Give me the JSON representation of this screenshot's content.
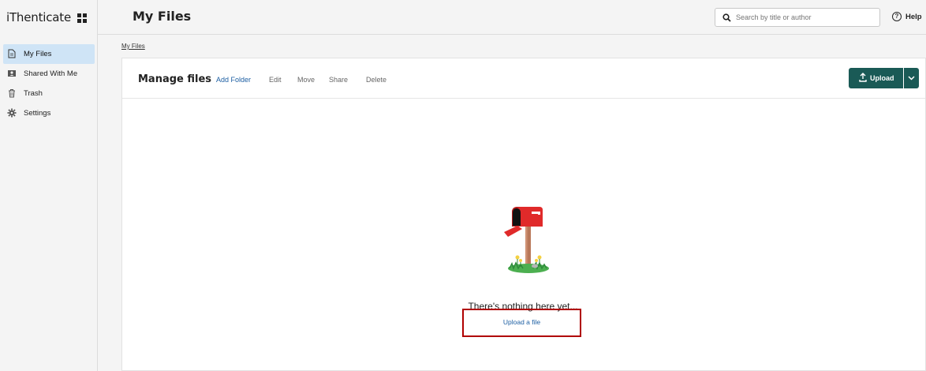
{
  "app": {
    "brand": "iThenticate"
  },
  "sidebar": {
    "items": [
      {
        "label": "My Files",
        "icon": "file-icon",
        "active": true
      },
      {
        "label": "Shared With Me",
        "icon": "shared-icon",
        "active": false
      },
      {
        "label": "Trash",
        "icon": "trash-icon",
        "active": false
      },
      {
        "label": "Settings",
        "icon": "gear-icon",
        "active": false
      }
    ]
  },
  "header": {
    "title": "My Files",
    "search_placeholder": "Search by title or author",
    "help_label": "Help"
  },
  "breadcrumb": {
    "label": "My Files"
  },
  "toolbar": {
    "title": "Manage files",
    "actions": [
      "Add Folder",
      "Edit",
      "Move",
      "Share",
      "Delete"
    ],
    "upload_label": "Upload"
  },
  "empty_state": {
    "message": "There's nothing here yet...",
    "link_label": "Upload a file"
  },
  "colors": {
    "accent": "#1a5a56",
    "link": "#1d5fa3",
    "active_nav": "#cfe4f6",
    "highlight_box": "#b00000"
  }
}
